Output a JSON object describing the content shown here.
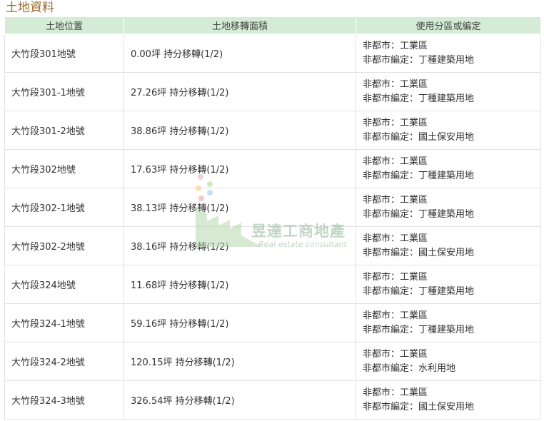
{
  "section_title": "土地資料",
  "table": {
    "headers": [
      "土地位置",
      "土地移轉面積",
      "使用分區或編定"
    ],
    "rows": [
      {
        "location": "大竹段301地號",
        "area": "0.00坪 持分移轉(1/2)",
        "zone1": "非都市：工業區",
        "zone2": "非都市編定：丁種建築用地"
      },
      {
        "location": "大竹段301-1地號",
        "area": "27.26坪 持分移轉(1/2)",
        "zone1": "非都市：工業區",
        "zone2": "非都市編定：丁種建築用地"
      },
      {
        "location": "大竹段301-2地號",
        "area": "38.86坪 持分移轉(1/2)",
        "zone1": "非都市：工業區",
        "zone2": "非都市編定：國土保安用地"
      },
      {
        "location": "大竹段302地號",
        "area": "17.63坪 持分移轉(1/2)",
        "zone1": "非都市：工業區",
        "zone2": "非都市編定：丁種建築用地"
      },
      {
        "location": "大竹段302-1地號",
        "area": "38.13坪 持分移轉(1/2)",
        "zone1": "非都市：工業區",
        "zone2": "非都市編定：丁種建築用地"
      },
      {
        "location": "大竹段302-2地號",
        "area": "38.16坪 持分移轉(1/2)",
        "zone1": "非都市：工業區",
        "zone2": "非都市編定：國土保安用地"
      },
      {
        "location": "大竹段324地號",
        "area": "11.68坪 持分移轉(1/2)",
        "zone1": "非都市：工業區",
        "zone2": "非都市編定：丁種建築用地"
      },
      {
        "location": "大竹段324-1地號",
        "area": "59.16坪 持分移轉(1/2)",
        "zone1": "非都市：工業區",
        "zone2": "非都市編定：丁種建築用地"
      },
      {
        "location": "大竹段324-2地號",
        "area": "120.15坪 持分移轉(1/2)",
        "zone1": "非都市：工業區",
        "zone2": "非都市編定：水利用地"
      },
      {
        "location": "大竹段324-3地號",
        "area": "326.54坪 持分移轉(1/2)",
        "zone1": "非都市：工業區",
        "zone2": "非都市編定：國土保安用地"
      }
    ]
  },
  "watermark": {
    "name": "昱達工商地產",
    "tagline": "Real estate consultant"
  }
}
